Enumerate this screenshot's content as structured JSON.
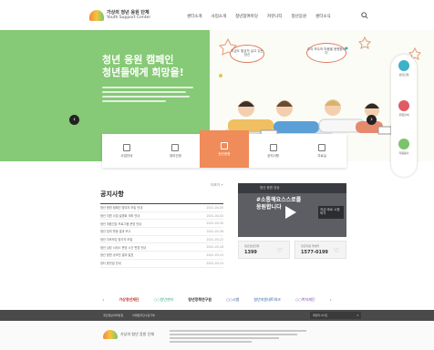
{
  "header": {
    "logo_text_ko": "가상의 청년 응원 단체",
    "logo_text_en": "Youth Support Center",
    "nav": [
      "센터소개",
      "사업소개",
      "청년참여마당",
      "커뮤니티",
      "청년응원",
      "센터소식"
    ]
  },
  "hero": {
    "title_line1": "청년 응원 캠페인",
    "title_line2": "청년들에게 희망을!",
    "bubble1": "지금도 열심히 살고 있는 당신",
    "bubble2": "우리 모두의 마음을 응원합니다"
  },
  "side_menu": {
    "items": [
      {
        "label": "상담신청",
        "color": "#3db1c8"
      },
      {
        "label": "후원안내",
        "color": "#e15b64"
      },
      {
        "label": "자원봉사",
        "color": "#7cc36b"
      }
    ]
  },
  "quick_menu": {
    "items": [
      "사업안내",
      "참여신청",
      "청년응원",
      "공지사항",
      "자료실"
    ],
    "active_index": 2
  },
  "notice": {
    "title": "공지사항",
    "more": "더보기 +",
    "rows": [
      {
        "title": "청년 응원 캠페인 참여자 모집 안내",
        "date": "2021-04-05"
      },
      {
        "title": "청년 지원 사업 설명회 개최 안내",
        "date": "2021-04-02"
      },
      {
        "title": "청년 마음건강 프로그램 운영 안내",
        "date": "2021-03-30"
      },
      {
        "title": "청년 참여 활동 결과 보고",
        "date": "2021-03-26"
      },
      {
        "title": "청년 자조모임 참가자 모집",
        "date": "2021-03-22"
      },
      {
        "title": "청년 상담 서비스 운영 시간 변경 안내",
        "date": "2021-03-18"
      },
      {
        "title": "청년 응원 공모전 결과 발표",
        "date": "2021-03-15"
      },
      {
        "title": "센터 휴관일 안내",
        "date": "2021-03-10"
      }
    ]
  },
  "video": {
    "top": "청년 응원 영상",
    "main_line1": "#소통해요스스로를",
    "main_line2": "응원합니다",
    "tag": "지금 바로 시청하기"
  },
  "hotlines": [
    {
      "label": "청년상담전화",
      "number": "1399"
    },
    {
      "label": "청년지원 콜센터",
      "number": "1577-0199"
    }
  ],
  "partners": [
    "가상청년재단",
    "○○청년센터",
    "청년정책연구원",
    "○○시청",
    "청년지원네트워크",
    "○○복지재단"
  ],
  "footer": {
    "links": [
      "개인정보처리방침",
      "이메일무단수집거부"
    ],
    "family_site": "패밀리사이트",
    "logo_text": "가상의 청년 응원 단체"
  }
}
